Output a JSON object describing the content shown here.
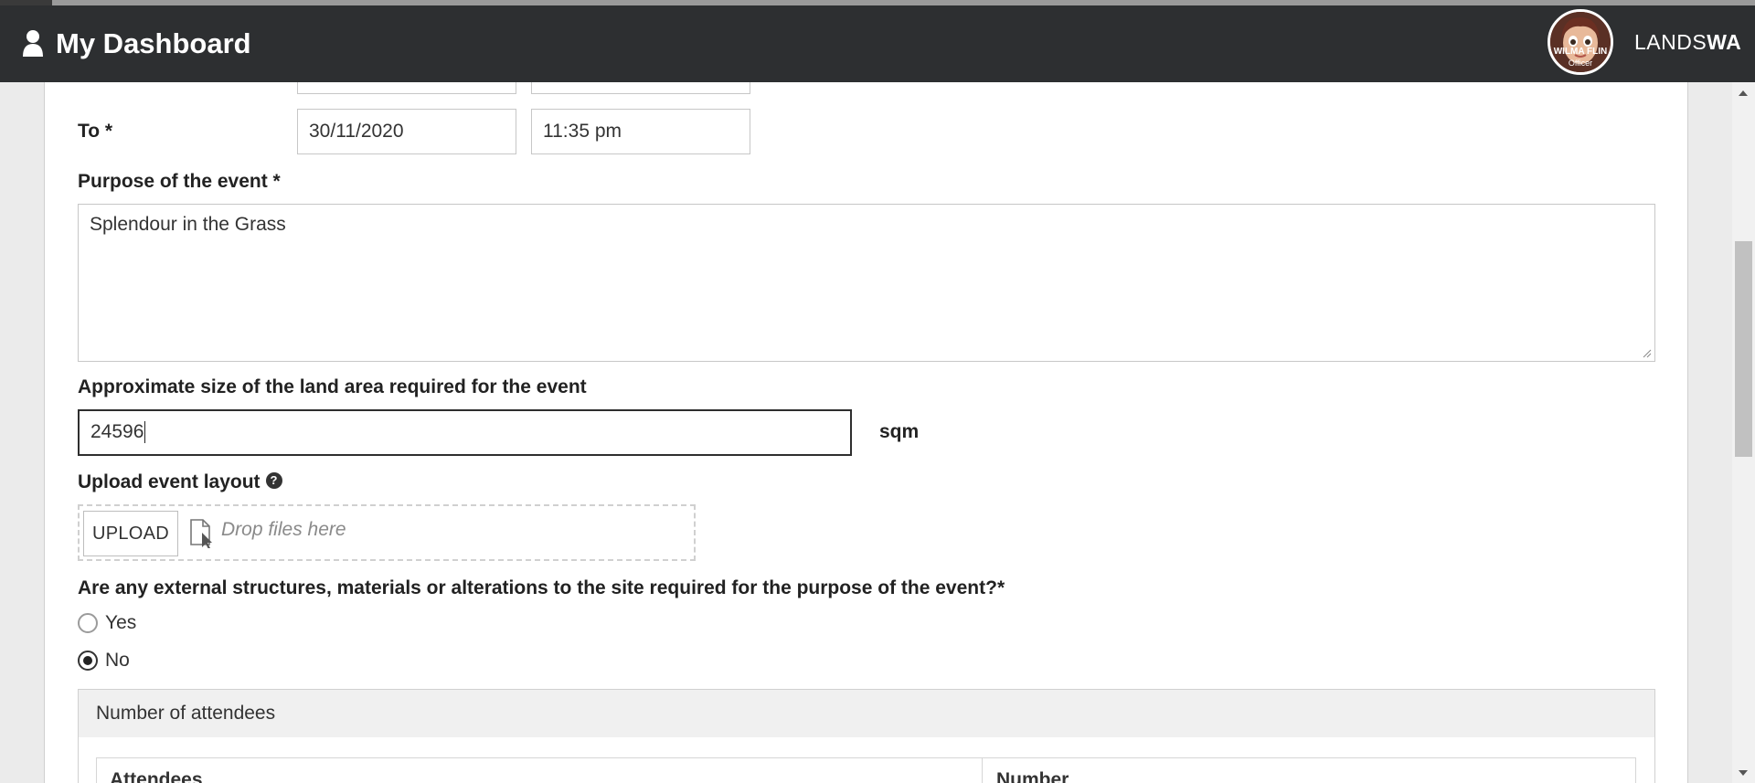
{
  "header": {
    "title": "My Dashboard",
    "brand_light": "LANDS",
    "brand_bold": "WA",
    "avatar": {
      "name": "WILMA FLIN",
      "role": "Officer"
    }
  },
  "form": {
    "to_label": "To *",
    "to_date": "30/11/2020",
    "to_time": "11:35 pm",
    "purpose_label": "Purpose of the event *",
    "purpose_value": "Splendour in the Grass",
    "area_label": "Approximate size of the land area required for the event",
    "area_value": "24596",
    "area_unit": "sqm",
    "upload_label": "Upload event layout",
    "upload_button": "UPLOAD",
    "drop_placeholder": "Drop files here",
    "structures_question": "Are any external structures, materials or alterations to the site required for the purpose of the event?",
    "required_mark": "*",
    "options": [
      {
        "label": "Yes",
        "selected": false
      },
      {
        "label": "No",
        "selected": true
      }
    ]
  },
  "attendees": {
    "title": "Number of attendees",
    "columns": [
      "Attendees",
      "Number"
    ]
  },
  "icons": {
    "user": "user-icon",
    "help": "question-circle-icon",
    "file": "file-drop-icon"
  }
}
